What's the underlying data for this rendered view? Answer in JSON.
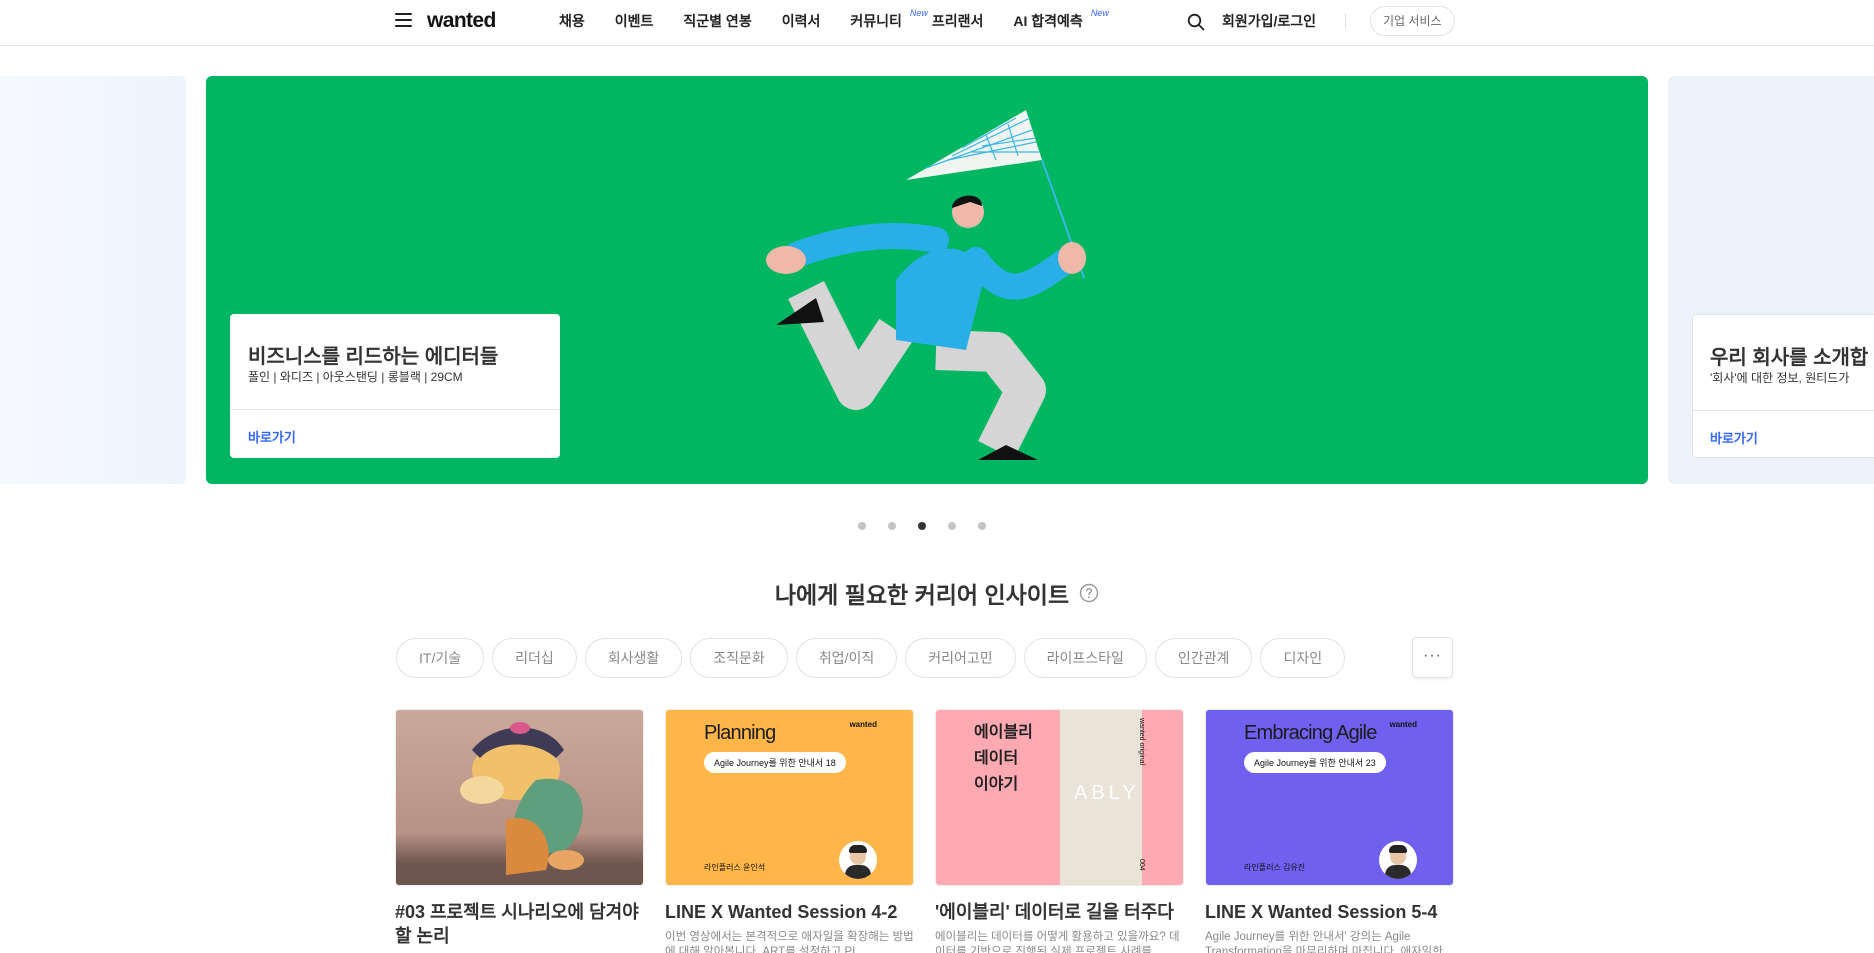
{
  "header": {
    "logo": "wanted",
    "nav": [
      {
        "label": "채용",
        "badge": ""
      },
      {
        "label": "이벤트",
        "badge": ""
      },
      {
        "label": "직군별 연봉",
        "badge": ""
      },
      {
        "label": "이력서",
        "badge": ""
      },
      {
        "label": "커뮤니티",
        "badge": "New"
      },
      {
        "label": "프리랜서",
        "badge": ""
      },
      {
        "label": "AI 합격예측",
        "badge": "New"
      }
    ],
    "login": "회원가입/로그인",
    "business_button": "기업 서비스"
  },
  "carousel": {
    "main_card": {
      "title": "비즈니스를 리드하는 에디터들",
      "subtitle": "폴인 | 와디즈 | 아웃스탠딩 | 롱블랙 | 29CM",
      "link": "바로가기"
    },
    "next_card": {
      "title": "우리 회사를 소개합",
      "subtitle": "'회사'에 대한 정보, 원티드가",
      "link": "바로가기"
    },
    "main_color": "#00b661",
    "dots_count": 5,
    "active_dot": 3
  },
  "insights": {
    "title": "나에게 필요한 커리어 인사이트",
    "chips": [
      "IT/기술",
      "리더십",
      "회사생활",
      "조직문화",
      "취업/이직",
      "커리어고민",
      "라이프스타일",
      "인간관계",
      "디자인"
    ],
    "more_label": "···",
    "cards": [
      {
        "title": "#03 프로젝트 시나리오에 담겨야 할 논리",
        "desc": "",
        "thumb": {}
      },
      {
        "title": "LINE X Wanted Session 4-2",
        "desc": "이번 영상에서는 본격적으로 애자일을 확장해는 방법에 대해 알아봅니다. ART를 설정하고 PI",
        "thumb": {
          "title": "Planning",
          "brand": "wanted",
          "pill": "Agile Journey를 위한 안내서 18",
          "name": "라인플러스 윤인석"
        }
      },
      {
        "title": "'에이블리' 데이터로 길을 터주다",
        "desc": "에이블리는 데이터를 어떻게 활용하고 있을까요? 데이터를 기반으로 진행된 실제 프로젝트 사례를",
        "thumb": {
          "title": "에이블리\n데이터\n이야기",
          "panel": "ABLY",
          "vertical": "wanted original",
          "number": "004"
        }
      },
      {
        "title": "LINE X Wanted Session 5-4",
        "desc": "Agile Journey를 위한 안내서' 강의는 Agile Transformation을 마무리하며 마칩니다. 애자일한",
        "thumb": {
          "title": "Embracing Agile",
          "brand": "wanted",
          "pill": "Agile Journey를 위한 안내서 23",
          "name": "라인플러스 김유진"
        }
      }
    ]
  }
}
